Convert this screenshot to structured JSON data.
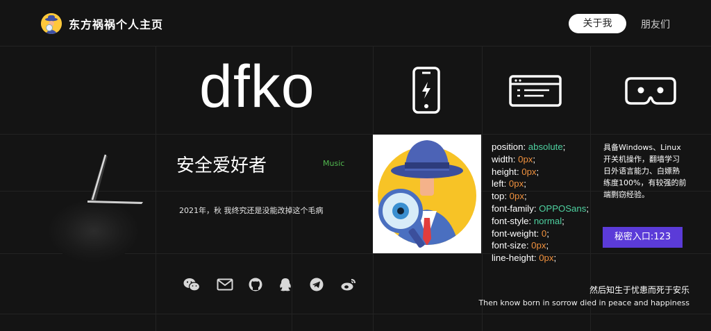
{
  "header": {
    "site_title": "东方祸祸个人主页",
    "nav": {
      "about": "关于我",
      "friends": "朋友们"
    }
  },
  "hero": {
    "name": "dfko",
    "tagline": "安全爱好者",
    "music_label": "Music",
    "note": "2021年，秋 我终究还是没能改掉这个毛病"
  },
  "feature_icons": [
    "mobile-flash-icon",
    "browser-window-icon",
    "vr-glasses-icon"
  ],
  "css_panel": [
    {
      "prop": "position",
      "value": "absolute",
      "kind": "green"
    },
    {
      "prop": "width",
      "value": "0px",
      "kind": "orange"
    },
    {
      "prop": "height",
      "value": "0px",
      "kind": "orange"
    },
    {
      "prop": "left",
      "value": "0px",
      "kind": "orange"
    },
    {
      "prop": "top",
      "value": "0px",
      "kind": "orange"
    },
    {
      "prop": "font-family",
      "value": "OPPOSans",
      "kind": "green"
    },
    {
      "prop": "font-style",
      "value": "normal",
      "kind": "green"
    },
    {
      "prop": "font-weight",
      "value": "0",
      "kind": "orange"
    },
    {
      "prop": "font-size",
      "value": "0px",
      "kind": "orange"
    },
    {
      "prop": "line-height",
      "value": "0px",
      "kind": "orange"
    }
  ],
  "about": {
    "description": "具备Windows、Linux开关机操作，翻墙学习日外语言能力、白嫖熟练度100%，有较强的前端剽窃经验。",
    "secret_button": "秘密入口:123"
  },
  "social_icons": [
    "wechat-icon",
    "mail-icon",
    "github-icon",
    "qq-icon",
    "telegram-icon",
    "weibo-icon"
  ],
  "quote": {
    "cn": "然后知生于忧患而死于安乐",
    "en": "Then know born in sorrow died in peace and happiness"
  },
  "colors": {
    "accent": "#5b3bd8",
    "music": "#51b84f",
    "value_green": "#4ed1a0",
    "value_orange": "#f0913e"
  }
}
